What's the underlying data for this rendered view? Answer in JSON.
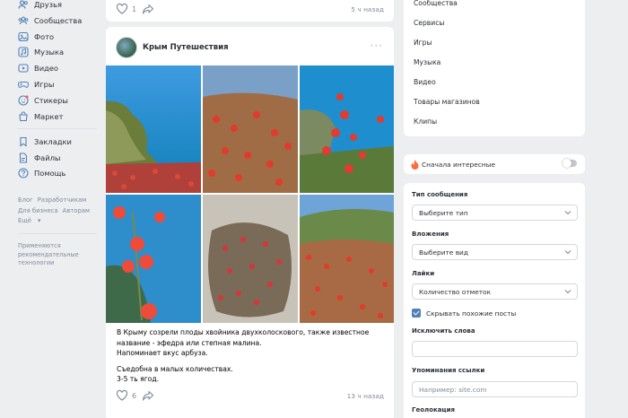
{
  "nav": {
    "items": [
      {
        "label": "Друзья",
        "icon": "friends-icon"
      },
      {
        "label": "Сообщества",
        "icon": "communities-icon"
      },
      {
        "label": "Фото",
        "icon": "photo-icon"
      },
      {
        "label": "Музыка",
        "icon": "music-icon"
      },
      {
        "label": "Видео",
        "icon": "video-icon"
      },
      {
        "label": "Игры",
        "icon": "games-icon"
      },
      {
        "label": "Стикеры",
        "icon": "stickers-icon"
      },
      {
        "label": "Маркет",
        "icon": "market-icon"
      }
    ],
    "items2": [
      {
        "label": "Закладки",
        "icon": "bookmarks-icon"
      },
      {
        "label": "Файлы",
        "icon": "files-icon"
      },
      {
        "label": "Помощь",
        "icon": "help-icon"
      }
    ],
    "footer_links": [
      "Блог",
      "Разработчикам",
      "Для бизнеса",
      "Авторам",
      "Ещё"
    ],
    "note": "Применяются рекомендательные технологии"
  },
  "feed": {
    "prev_post": {
      "likes": "1",
      "time": "5 ч назад"
    },
    "post": {
      "author": "Крым Путешествия",
      "text_lines": [
        "В Крыму созрели плоды хвойника двухколоскового, также известное название - эфедра или степная малина.",
        "Напоминает вкус арбуза."
      ],
      "text_lines2": [
        "Съедобна в малых количествах.",
        "3-5 ть ягод."
      ],
      "likes": "6",
      "time": "13 ч назад"
    }
  },
  "right": {
    "menu": [
      "Сообщества",
      "Сервисы",
      "Игры",
      "Музыка",
      "Видео",
      "Товары магазинов",
      "Клипы"
    ],
    "sort_label": "Сначала интересные",
    "filters": {
      "msg_type_label": "Тип сообщения",
      "msg_type_value": "Выберите тип",
      "attach_label": "Вложения",
      "attach_value": "Выберите вид",
      "likes_label": "Лайки",
      "likes_value": "Количество отметок",
      "hide_similar": "Скрывать похожие посты",
      "exclude_label": "Исключить слова",
      "mentions_label": "Упоминания ссылки",
      "mentions_placeholder": "Например: site.com",
      "geo_label": "Геолокация"
    }
  },
  "colors": {
    "accent": "#5181b8",
    "background": "#edeef0"
  }
}
